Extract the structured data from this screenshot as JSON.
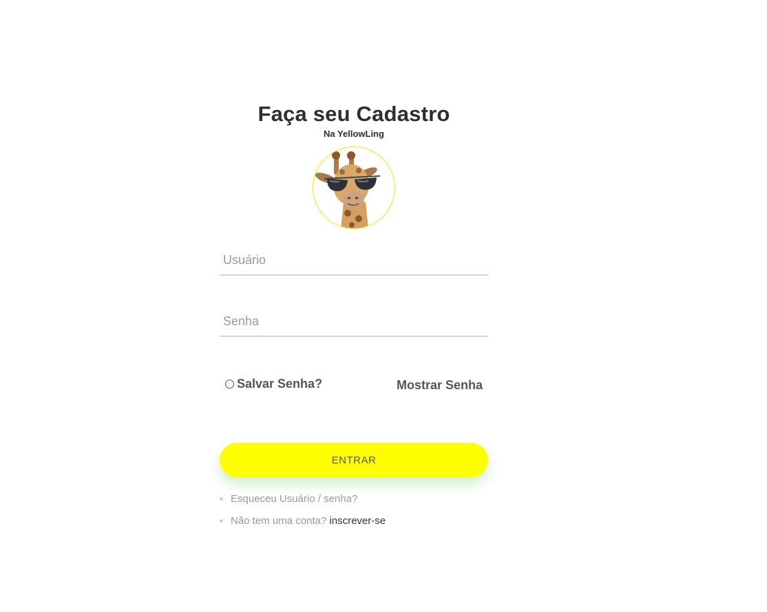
{
  "header": {
    "title": "Faça seu Cadastro",
    "subtitle": "Na YellowLing"
  },
  "avatar": {
    "icon": "giraffe-sunglasses-icon",
    "border_color": "#f2e600"
  },
  "form": {
    "username_placeholder": "Usuário",
    "password_placeholder": "Senha",
    "remember_label": "Salvar Senha?",
    "show_password_label": "Mostrar Senha",
    "submit_label": "ENTRAR"
  },
  "links": {
    "forgot": "Esqueceu Usuário / senha?",
    "no_account": "Não tem uma conta?",
    "signup": "inscrever-se"
  },
  "colors": {
    "accent": "#ffff00",
    "text": "#2e2e2e",
    "muted": "#999999"
  }
}
